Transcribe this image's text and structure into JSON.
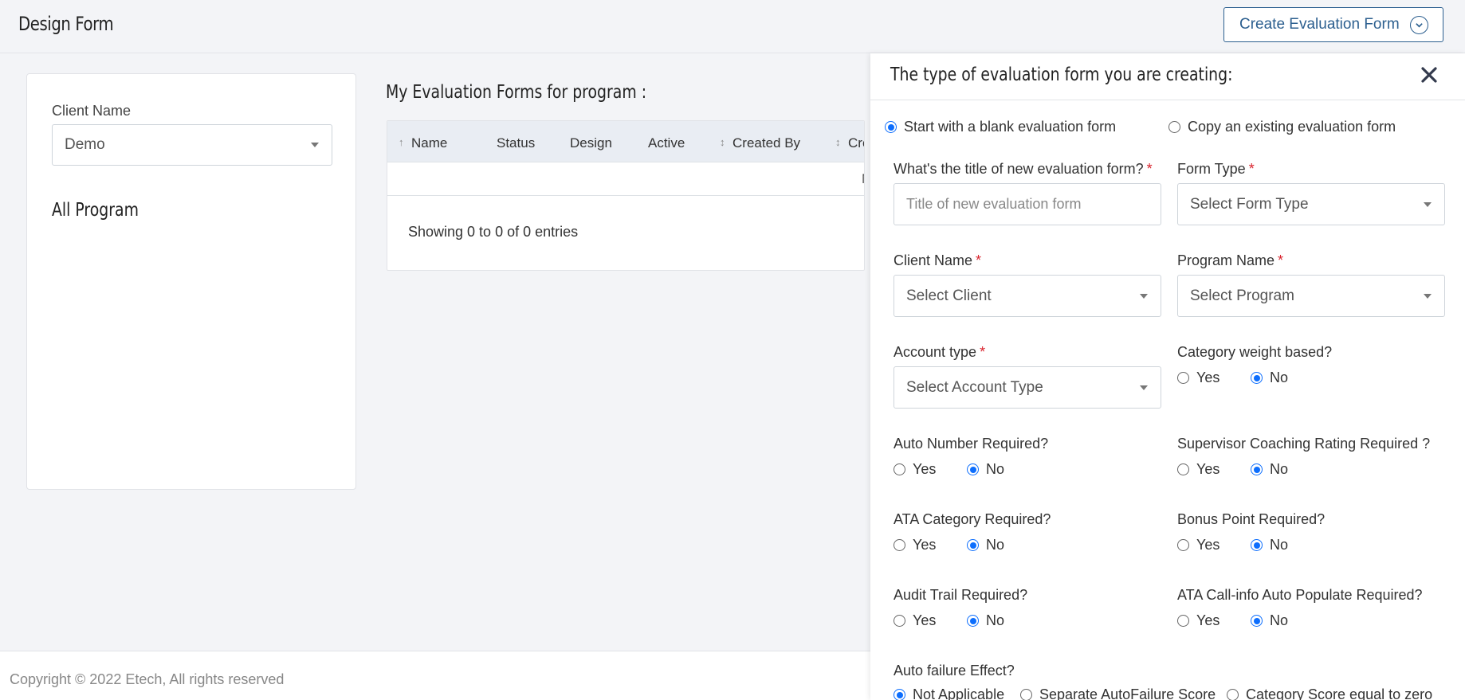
{
  "header": {
    "title": "Design Form",
    "create_button": "Create Evaluation Form"
  },
  "left_card": {
    "client_label": "Client Name",
    "client_value": "Demo",
    "program_heading": "All Program"
  },
  "main": {
    "title": "My Evaluation Forms for program :",
    "columns": [
      "Name",
      "Status",
      "Design",
      "Active",
      "Created By",
      "Crea"
    ],
    "empty_text": "N",
    "showing": "Showing 0 to 0 of 0 entries"
  },
  "footer": {
    "copyright": "Copyright © 2022 Etech, All rights reserved"
  },
  "panel": {
    "title": "The type of evaluation form you are creating:",
    "mode_options": [
      "Start with a blank evaluation form",
      "Copy an existing evaluation form"
    ],
    "required_mark": "*",
    "title_field": {
      "label": "What's the title of new evaluation form?",
      "placeholder": "Title of new evaluation form"
    },
    "form_type": {
      "label": "Form Type",
      "value": "Select Form Type"
    },
    "client": {
      "label": "Client Name",
      "value": "Select Client"
    },
    "program": {
      "label": "Program Name",
      "value": "Select Program"
    },
    "account_type": {
      "label": "Account type",
      "value": "Select Account Type"
    },
    "yes": "Yes",
    "no": "No",
    "questions": {
      "category_weight": "Category weight based?",
      "auto_number": "Auto Number Required?",
      "supervisor_coaching": "Supervisor Coaching Rating Required ?",
      "ata_category": "ATA Category Required?",
      "bonus_point": "Bonus Point Required?",
      "audit_trail": "Audit Trail Required?",
      "ata_callinfo": "ATA Call-info Auto Populate Required?",
      "auto_failure": "Auto failure Effect?"
    },
    "auto_failure_options": [
      "Not Applicable",
      "Separate AutoFailure Score",
      "Category Score equal to zero"
    ]
  }
}
